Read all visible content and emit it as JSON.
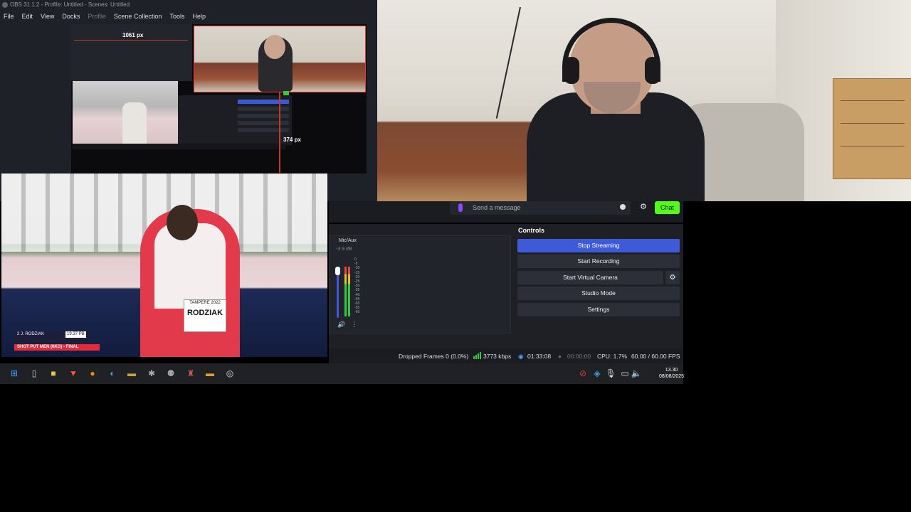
{
  "window": {
    "title": "OBS 31.1.2 - Profile: Untitled - Scenes: Untitled"
  },
  "menu": [
    {
      "label": "File",
      "enabled": true
    },
    {
      "label": "Edit",
      "enabled": true
    },
    {
      "label": "View",
      "enabled": true
    },
    {
      "label": "Docks",
      "enabled": true
    },
    {
      "label": "Profile",
      "enabled": false
    },
    {
      "label": "Scene Collection",
      "enabled": true
    },
    {
      "label": "Tools",
      "enabled": true
    },
    {
      "label": "Help",
      "enabled": true
    }
  ],
  "preview": {
    "width_label": "1061 px",
    "height_label": "374 px"
  },
  "sport_overlay": {
    "athlete_line": "2  J. RODZIAK",
    "pb_value": "19.37",
    "pb_label": "PB",
    "event": "SHOT PUT MEN (6KG) - FINAL",
    "bib_name": "RODZIAK",
    "bib_sub": "TAMPERE 2022"
  },
  "chat": {
    "placeholder": "Send a message",
    "button_label": "Chat",
    "accent_color": "#53fc18"
  },
  "mixer": {
    "source_name": "Mic/Aux",
    "db_value": "-3.9 dB",
    "scale": [
      "0",
      "-5",
      "-10",
      "-15",
      "-20",
      "-25",
      "-30",
      "-35",
      "-40",
      "-45",
      "-50",
      "-55",
      "-60"
    ]
  },
  "controls": {
    "title": "Controls",
    "stop_streaming": "Stop Streaming",
    "start_recording": "Start Recording",
    "start_virtual_camera": "Start Virtual Camera",
    "studio_mode": "Studio Mode",
    "settings": "Settings",
    "accent_color": "#3d5ad8"
  },
  "status": {
    "dropped_frames": "Dropped Frames 0 (0.0%)",
    "bitrate": "3773 kbps",
    "stream_time": "01:33:08",
    "record_time": "00:00:00",
    "cpu": "CPU: 1.7%",
    "fps": "60.00 / 60.00 FPS"
  },
  "taskbar": {
    "icons": [
      "windows-start-icon",
      "notepad-icon",
      "file-explorer-icon",
      "brave-browser-icon",
      "firefox-icon",
      "edge-icon",
      "app-icon-1",
      "app-icon-2",
      "app-icon-3",
      "app-icon-4",
      "app-icon-5",
      "obs-icon"
    ],
    "tray": [
      "antivirus-icon",
      "network-icon",
      "microphone-icon",
      "display-icon",
      "volume-icon"
    ],
    "time": "13.30",
    "date": "08/08/2025"
  }
}
